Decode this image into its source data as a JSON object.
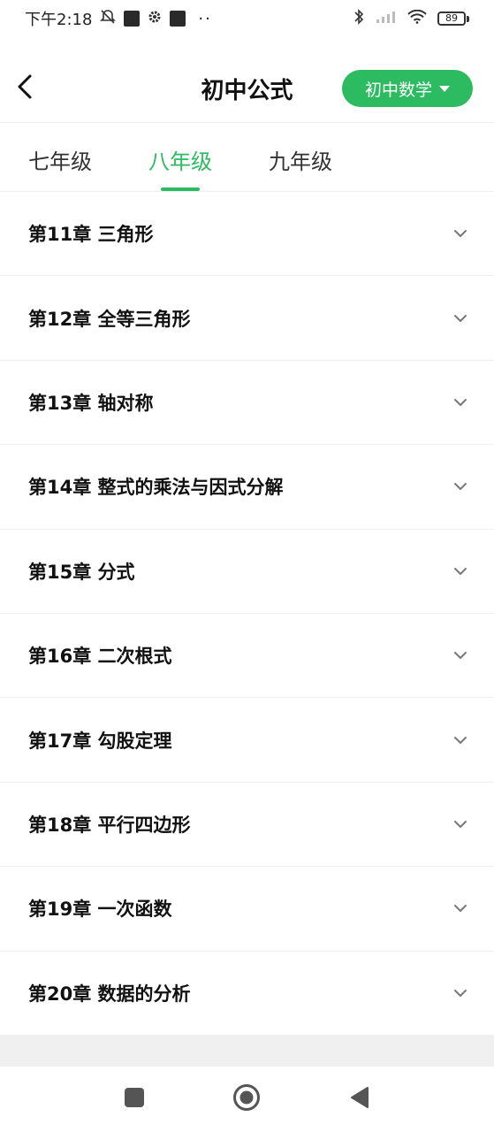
{
  "status_bar": {
    "time": "下午2:18",
    "battery": "89"
  },
  "header": {
    "title": "初中公式",
    "subject_label": "初中数学"
  },
  "tabs": [
    {
      "label": "七年级",
      "active": false
    },
    {
      "label": "八年级",
      "active": true
    },
    {
      "label": "九年级",
      "active": false
    }
  ],
  "chapters": [
    {
      "label": "第11章 三角形"
    },
    {
      "label": "第12章 全等三角形"
    },
    {
      "label": "第13章 轴对称"
    },
    {
      "label": "第14章 整式的乘法与因式分解"
    },
    {
      "label": "第15章 分式"
    },
    {
      "label": "第16章 二次根式"
    },
    {
      "label": "第17章 勾股定理"
    },
    {
      "label": "第18章 平行四边形"
    },
    {
      "label": "第19章 一次函数"
    },
    {
      "label": "第20章 数据的分析"
    }
  ],
  "colors": {
    "accent": "#2dbb62"
  },
  "icons": {
    "back": "back-arrow-icon",
    "dropdown": "caret-down-icon",
    "expand": "chevron-down-icon",
    "nav_recents": "square-icon",
    "nav_home": "circle-icon",
    "nav_back": "triangle-back-icon"
  }
}
